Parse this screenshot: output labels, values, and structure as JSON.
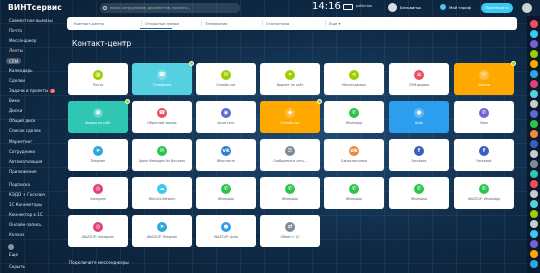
{
  "header": {
    "logo": "ВИНТсервис",
    "search_placeholder": "поиск сотрудников, документов, прочего...",
    "clock": "14:16",
    "clock_status": "работаю",
    "user_name": "Бельвиньк",
    "plan_label": "Мой тариф",
    "invite_label": "Пригласить"
  },
  "left_menu": [
    {
      "label": "Совместное вымазы",
      "active": false
    },
    {
      "label": "Почта",
      "active": false
    },
    {
      "label": "Мессенджер",
      "active": false
    },
    {
      "label": "Ленты",
      "active": false
    },
    {
      "label": "CRM",
      "active": true
    },
    {
      "label": "Календарь",
      "active": false
    },
    {
      "label": "Сделки",
      "active": false
    },
    {
      "label": "Задачи и проекты",
      "active": false,
      "badge": "2"
    },
    {
      "label": "Вики",
      "active": false
    },
    {
      "label": "Диски",
      "active": false
    },
    {
      "label": "Общий диск",
      "active": false
    },
    {
      "label": "Список сделок",
      "active": false
    },
    {
      "label": "Маркетинг",
      "active": false
    },
    {
      "label": "Сотрудники",
      "active": false
    },
    {
      "label": "Автоматизация",
      "active": false
    },
    {
      "label": "Приложения",
      "active": false
    },
    {
      "label": "Подписка",
      "active": false
    },
    {
      "label": "КЭДО + Госключ",
      "active": false
    },
    {
      "label": "1С Коннекторы",
      "active": false
    },
    {
      "label": "Коннектор к 1С",
      "active": false
    },
    {
      "label": "Онлайн-запись",
      "active": false
    },
    {
      "label": "Колхоз",
      "active": false
    },
    {
      "label": "Еще",
      "active": false
    },
    {
      "label": "Скрыть",
      "active": false
    }
  ],
  "tabs": [
    {
      "label": "Контакт-центр",
      "active": true
    },
    {
      "label": "Открытые линии",
      "active": false
    },
    {
      "label": "Телефония",
      "active": false
    },
    {
      "label": "Статистика",
      "active": false
    },
    {
      "label": "Еще",
      "active": false
    }
  ],
  "page_title": "Контакт-центр",
  "tiles": [
    {
      "label": "Почта",
      "color": "#ffffff",
      "icon_color": "#9dcf00",
      "icon": "mail-icon",
      "glyph": "@",
      "connected": false
    },
    {
      "label": "Телефония",
      "color": "#55d0e0",
      "icon_color": "#ffffff",
      "icon": "phone-icon",
      "glyph": "☎",
      "connected": true
    },
    {
      "label": "Онлайн-чат",
      "color": "#ffffff",
      "icon_color": "#9dcf00",
      "icon": "chat-icon",
      "glyph": "✉",
      "connected": false
    },
    {
      "label": "Виджет на сайт",
      "color": "#ffffff",
      "icon_color": "#9dcf00",
      "icon": "widget-icon",
      "glyph": "✦",
      "connected": false
    },
    {
      "label": "Мессенджеры",
      "color": "#ffffff",
      "icon_color": "#9dcf00",
      "icon": "share-icon",
      "glyph": "<",
      "connected": false
    },
    {
      "label": "CRM-формы",
      "color": "#ffffff",
      "icon_color": "#f04d5c",
      "icon": "form-icon",
      "glyph": "≡",
      "connected": false
    },
    {
      "label": "Звонки",
      "color": "#ffa900",
      "icon_color": "#ffffff",
      "icon": "call-icon",
      "glyph": "☏",
      "connected": true
    },
    {
      "label": "Формы на сайт",
      "color": "#2fc6b4",
      "icon_color": "#ffffff",
      "icon": "form-site-icon",
      "glyph": "▣",
      "connected": true
    },
    {
      "label": "Обратный звонок",
      "color": "#ffffff",
      "icon_color": "#f04d5c",
      "icon": "callback-icon",
      "glyph": "☎",
      "connected": false
    },
    {
      "label": "Ассистент",
      "color": "#ffffff",
      "icon_color": "#5b6ad4",
      "icon": "assistant-icon",
      "glyph": "◉",
      "connected": false
    },
    {
      "label": "Онлайн-чат",
      "color": "#ffa900",
      "icon_color": "#ffffff",
      "icon": "chat-bubble-icon",
      "glyph": "◆",
      "connected": true
    },
    {
      "label": "WhatsApp",
      "color": "#ffffff",
      "icon_color": "#2cc54c",
      "icon": "whatsapp-icon",
      "glyph": "✆",
      "connected": false
    },
    {
      "label": "Avito",
      "color": "#2c9ef0",
      "icon_color": "#ffffff",
      "icon": "avito-icon",
      "glyph": "●",
      "connected": false
    },
    {
      "label": "Viber",
      "color": "#ffffff",
      "icon_color": "#7a5fd4",
      "icon": "viber-icon",
      "glyph": "✆",
      "connected": false
    },
    {
      "label": "Telegram",
      "color": "#ffffff",
      "icon_color": "#2ea7e0",
      "icon": "telegram-icon",
      "glyph": "➤",
      "connected": false
    },
    {
      "label": "Apple Messages for Business",
      "color": "#ffffff",
      "icon_color": "#2cc54c",
      "icon": "apple-icon",
      "glyph": "✉",
      "connected": false
    },
    {
      "label": "ВКонтакте",
      "color": "#ffffff",
      "icon_color": "#2b7fd5",
      "icon": "vk-icon",
      "glyph": "vk",
      "connected": false
    },
    {
      "label": "Сообщения в сеть...",
      "color": "#ffffff",
      "icon_color": "#7f8b99",
      "icon": "network-icon",
      "glyph": "☰",
      "connected": false
    },
    {
      "label": "Одноклассники",
      "color": "#ffffff",
      "icon_color": "#f0883c",
      "icon": "ok-icon",
      "glyph": "ok",
      "connected": false
    },
    {
      "label": "Facebook",
      "color": "#ffffff",
      "icon_color": "#3b5fbf",
      "icon": "facebook-icon",
      "glyph": "f",
      "connected": false
    },
    {
      "label": "Facebook",
      "color": "#ffffff",
      "icon_color": "#3b5fbf",
      "icon": "facebook-comments-icon",
      "glyph": "f",
      "connected": false
    },
    {
      "label": "Instagram",
      "color": "#ffffff",
      "icon_color": "#e4407a",
      "icon": "instagram-icon",
      "glyph": "◎",
      "connected": false
    },
    {
      "label": "Bitrix24.Network",
      "color": "#ffffff",
      "icon_color": "#3bc8f5",
      "icon": "network-cloud-icon",
      "glyph": "☁",
      "connected": false
    },
    {
      "label": "WhatsApp",
      "color": "#ffffff",
      "icon_color": "#2cc54c",
      "icon": "whatsapp-2-icon",
      "glyph": "✆",
      "connected": false
    },
    {
      "label": "WhatsApp",
      "color": "#ffffff",
      "icon_color": "#2cc54c",
      "icon": "whatsapp-3-icon",
      "glyph": "✆",
      "connected": false
    },
    {
      "label": "WhatsApp",
      "color": "#ffffff",
      "icon_color": "#2cc54c",
      "icon": "whatsapp-4-icon",
      "glyph": "✆",
      "connected": false
    },
    {
      "label": "WhatsApp",
      "color": "#ffffff",
      "icon_color": "#2cc54c",
      "icon": "whatsapp-5-icon",
      "glyph": "✆",
      "connected": false
    },
    {
      "label": "WAZZUP: WhatsApp",
      "color": "#ffffff",
      "icon_color": "#2cc54c",
      "icon": "wazzup-whatsapp-icon",
      "glyph": "✆",
      "connected": false
    },
    {
      "label": "WAZZUP: Instagram",
      "color": "#ffffff",
      "icon_color": "#e4407a",
      "icon": "wazzup-instagram-icon",
      "glyph": "◎",
      "connected": false
    },
    {
      "label": "WAZZUP: Telegram",
      "color": "#ffffff",
      "icon_color": "#2ea7e0",
      "icon": "wazzup-telegram-icon",
      "glyph": "➤",
      "connected": false
    },
    {
      "label": "WAZZUP: Avito",
      "color": "#ffffff",
      "icon_color": "#2c9ef0",
      "icon": "wazzup-avito-icon",
      "glyph": "●",
      "connected": false
    },
    {
      "label": "Обмен с 1С",
      "color": "#ffffff",
      "icon_color": "#7f8b99",
      "icon": "exchange-1c-icon",
      "glyph": "⇄",
      "connected": false
    }
  ],
  "bottom_text": "Подключите мессенджеры",
  "right_panel_colors": [
    "#f04d5c",
    "#3bc8f5",
    "#7a5fd4",
    "#9dcf00",
    "#ffa900",
    "#2ea7e0",
    "#e4407a",
    "#55d0e0",
    "#c7ccd1",
    "#5b6ad4",
    "#2cc54c",
    "#f0883c",
    "#3b5fbf",
    "#c7ccd1",
    "#7f8b99",
    "#2fc6b4",
    "#f04d5c",
    "#c7ccd1",
    "#55d0e0",
    "#9dcf00",
    "#c7ccd1",
    "#3bc8f5",
    "#7a5fd4",
    "#ffa900",
    "#2ea7e0"
  ]
}
